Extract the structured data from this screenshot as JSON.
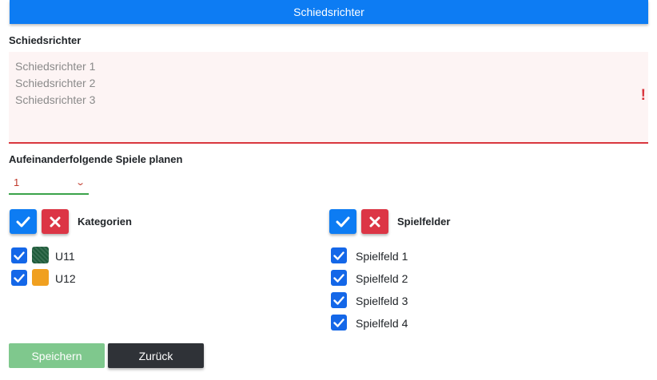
{
  "header": {
    "title": "Schiedsrichter"
  },
  "referees": {
    "label": "Schiedsrichter",
    "placeholder_lines": [
      "Schiedsrichter 1",
      "Schiedsrichter 2",
      "Schiedsrichter 3"
    ],
    "error_mark": "!"
  },
  "consecutive": {
    "label": "Aufeinanderfolgende Spiele planen",
    "selected": "1"
  },
  "categories": {
    "label": "Kategorien",
    "items": [
      {
        "label": "U11",
        "checked": true,
        "color": "#1e5b3a"
      },
      {
        "label": "U12",
        "checked": true,
        "color": "#f0a020"
      }
    ]
  },
  "fields": {
    "label": "Spielfelder",
    "items": [
      {
        "label": "Spielfeld 1",
        "checked": true
      },
      {
        "label": "Spielfeld 2",
        "checked": true
      },
      {
        "label": "Spielfeld 3",
        "checked": true
      },
      {
        "label": "Spielfeld 4",
        "checked": true
      }
    ]
  },
  "actions": {
    "save": "Speichern",
    "back": "Zurück"
  },
  "colors": {
    "primary": "#0d7cf3",
    "danger": "#dc3545",
    "success_disabled": "#7fc88d",
    "dark": "#2f3237"
  }
}
